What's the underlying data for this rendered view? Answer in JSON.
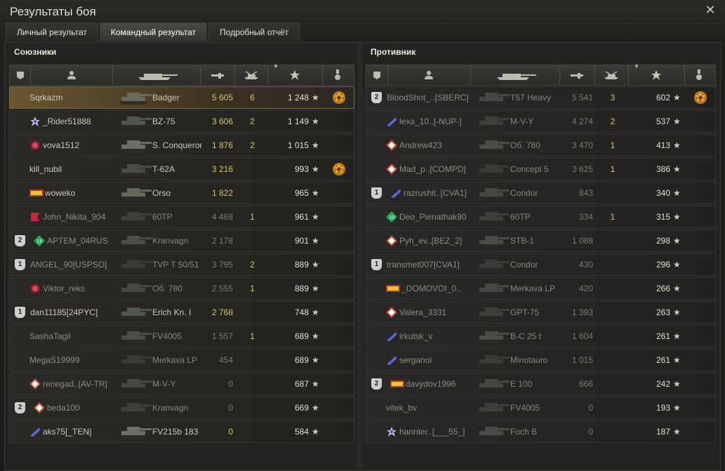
{
  "window": {
    "title": "Результаты боя",
    "close": "✕"
  },
  "tabs": [
    "Личный результат",
    "Командный результат",
    "Подробный отчёт"
  ],
  "allies": {
    "title": "Союзники",
    "rows": [
      {
        "platoon": "",
        "badge": "",
        "name": "Sqrkazm",
        "vehicle": "Badger",
        "damage": "5 605",
        "kills": "6",
        "exp": "1 248",
        "medal": true,
        "me": true,
        "dead": false
      },
      {
        "platoon": "",
        "badge": "star",
        "name": "_Rider51888",
        "vehicle": "BZ-75",
        "damage": "3 606",
        "kills": "2",
        "exp": "1 149",
        "medal": false,
        "dead": false
      },
      {
        "platoon": "",
        "badge": "red",
        "name": "vova1512",
        "vehicle": "S. Conqueror",
        "damage": "1 876",
        "kills": "2",
        "exp": "1 015",
        "medal": false,
        "dead": false
      },
      {
        "platoon": "",
        "badge": "",
        "name": "kill_nubil",
        "vehicle": "T-62A",
        "damage": "3 216",
        "kills": "",
        "exp": "993",
        "medal": true,
        "dead": false
      },
      {
        "platoon": "",
        "badge": "flag",
        "name": "woweko",
        "vehicle": "Orso",
        "damage": "1 822",
        "kills": "",
        "exp": "965",
        "medal": false,
        "dead": false
      },
      {
        "platoon": "",
        "badge": "redflag",
        "name": "John_Nikita_904",
        "vehicle": "60TP",
        "damage": "4 468",
        "kills": "1",
        "exp": "961",
        "medal": false,
        "dead": true
      },
      {
        "platoon": "2",
        "badge": "green",
        "name": "APTEM_04RUS",
        "vehicle": "Kranvagn",
        "damage": "2 178",
        "kills": "",
        "exp": "901",
        "medal": false,
        "dead": true
      },
      {
        "platoon": "1",
        "badge": "",
        "name": "ANGEL_90[USPSO]",
        "vehicle": "TVP T 50/51",
        "damage": "3 795",
        "kills": "2",
        "exp": "889",
        "medal": false,
        "dead": true
      },
      {
        "platoon": "",
        "badge": "red",
        "name": "Viktor_reks",
        "vehicle": "Об. 780",
        "damage": "2 555",
        "kills": "1",
        "exp": "889",
        "medal": false,
        "dead": true
      },
      {
        "platoon": "1",
        "badge": "",
        "name": "dan11185[24PYC]",
        "vehicle": "Erich Kn. I",
        "damage": "2 768",
        "kills": "",
        "exp": "748",
        "medal": false,
        "dead": false
      },
      {
        "platoon": "",
        "badge": "",
        "name": "SashaTagil",
        "vehicle": "FV4005",
        "damage": "1 557",
        "kills": "1",
        "exp": "689",
        "medal": false,
        "dead": true
      },
      {
        "platoon": "",
        "badge": "",
        "name": "MegaS19999",
        "vehicle": "Merkava LP",
        "damage": "454",
        "kills": "",
        "exp": "689",
        "medal": false,
        "dead": true
      },
      {
        "platoon": "",
        "badge": "diamond",
        "name": "renegad..[AV-TR]",
        "vehicle": "M-V-Y",
        "damage": "0",
        "kills": "",
        "exp": "687",
        "medal": false,
        "dead": true
      },
      {
        "platoon": "2",
        "badge": "diamond",
        "name": "beda100",
        "vehicle": "Kranvagn",
        "damage": "0",
        "kills": "",
        "exp": "669",
        "medal": false,
        "dead": true
      },
      {
        "platoon": "",
        "badge": "blue",
        "name": "aks75[_TEN]",
        "vehicle": "FV215b 183",
        "damage": "0",
        "kills": "",
        "exp": "584",
        "medal": false,
        "dead": false
      }
    ]
  },
  "enemies": {
    "title": "Противник",
    "rows": [
      {
        "platoon": "2",
        "badge": "",
        "name": "BloodShot_..[SBERC]",
        "vehicle": "T57 Heavy",
        "damage": "5 541",
        "kills": "3",
        "exp": "602",
        "medal": true,
        "dead": true
      },
      {
        "platoon": "",
        "badge": "blue",
        "name": "lexa_10..[-NUP-]",
        "vehicle": "M-V-Y",
        "damage": "4 274",
        "kills": "2",
        "exp": "537",
        "medal": false,
        "dead": true
      },
      {
        "platoon": "",
        "badge": "diamond",
        "name": "Andrew423",
        "vehicle": "Об. 780",
        "damage": "3 470",
        "kills": "1",
        "exp": "413",
        "medal": false,
        "dead": true
      },
      {
        "platoon": "",
        "badge": "diamond",
        "name": "Mad_p..[COMPD]",
        "vehicle": "Concept 5",
        "damage": "3 625",
        "kills": "1",
        "exp": "386",
        "medal": false,
        "dead": true
      },
      {
        "platoon": "1",
        "badge": "blue",
        "name": "razrushit..[CVA1]",
        "vehicle": "Condor",
        "damage": "843",
        "kills": "",
        "exp": "340",
        "medal": false,
        "dead": true
      },
      {
        "platoon": "",
        "badge": "green",
        "name": "Deo_Pienathak90",
        "vehicle": "60TP",
        "damage": "334",
        "kills": "1",
        "exp": "315",
        "medal": false,
        "dead": true
      },
      {
        "platoon": "",
        "badge": "diamond",
        "name": "Pyh_ev..[BEZ_2]",
        "vehicle": "STB-1",
        "damage": "1 088",
        "kills": "",
        "exp": "298",
        "medal": false,
        "dead": true
      },
      {
        "platoon": "1",
        "badge": "",
        "name": "transmet007[CVA1]",
        "vehicle": "Condor",
        "damage": "430",
        "kills": "",
        "exp": "296",
        "medal": false,
        "dead": true
      },
      {
        "platoon": "",
        "badge": "flag",
        "name": "_DOMOVOI_0..",
        "vehicle": "Merkava LP",
        "damage": "420",
        "kills": "",
        "exp": "266",
        "medal": false,
        "dead": true
      },
      {
        "platoon": "",
        "badge": "diamond",
        "name": "Valera_3331",
        "vehicle": "GPT-75",
        "damage": "1 393",
        "kills": "",
        "exp": "263",
        "medal": false,
        "dead": true
      },
      {
        "platoon": "",
        "badge": "blue",
        "name": "irkutsk_v",
        "vehicle": "B-C 25 t",
        "damage": "1 604",
        "kills": "",
        "exp": "261",
        "medal": false,
        "dead": true
      },
      {
        "platoon": "",
        "badge": "blue",
        "name": "serganoi",
        "vehicle": "Minotauro",
        "damage": "1 015",
        "kills": "",
        "exp": "261",
        "medal": false,
        "dead": true
      },
      {
        "platoon": "2",
        "badge": "flag",
        "name": "davydov1996",
        "vehicle": "E 100",
        "damage": "666",
        "kills": "",
        "exp": "242",
        "medal": false,
        "dead": true
      },
      {
        "platoon": "",
        "badge": "",
        "name": "vitek_bv",
        "vehicle": "FV4005",
        "damage": "0",
        "kills": "",
        "exp": "193",
        "medal": false,
        "dead": true
      },
      {
        "platoon": "",
        "badge": "star",
        "name": "hannter..[___55_]",
        "vehicle": "Foch B",
        "damage": "0",
        "kills": "",
        "exp": "187",
        "medal": false,
        "dead": true
      }
    ]
  },
  "star_glyph": "★",
  "icons": [
    "squad-icon",
    "player-icon",
    "tank-icon",
    "damage-icon",
    "kills-icon",
    "exp-star-icon",
    "medal-icon",
    "close-icon"
  ]
}
